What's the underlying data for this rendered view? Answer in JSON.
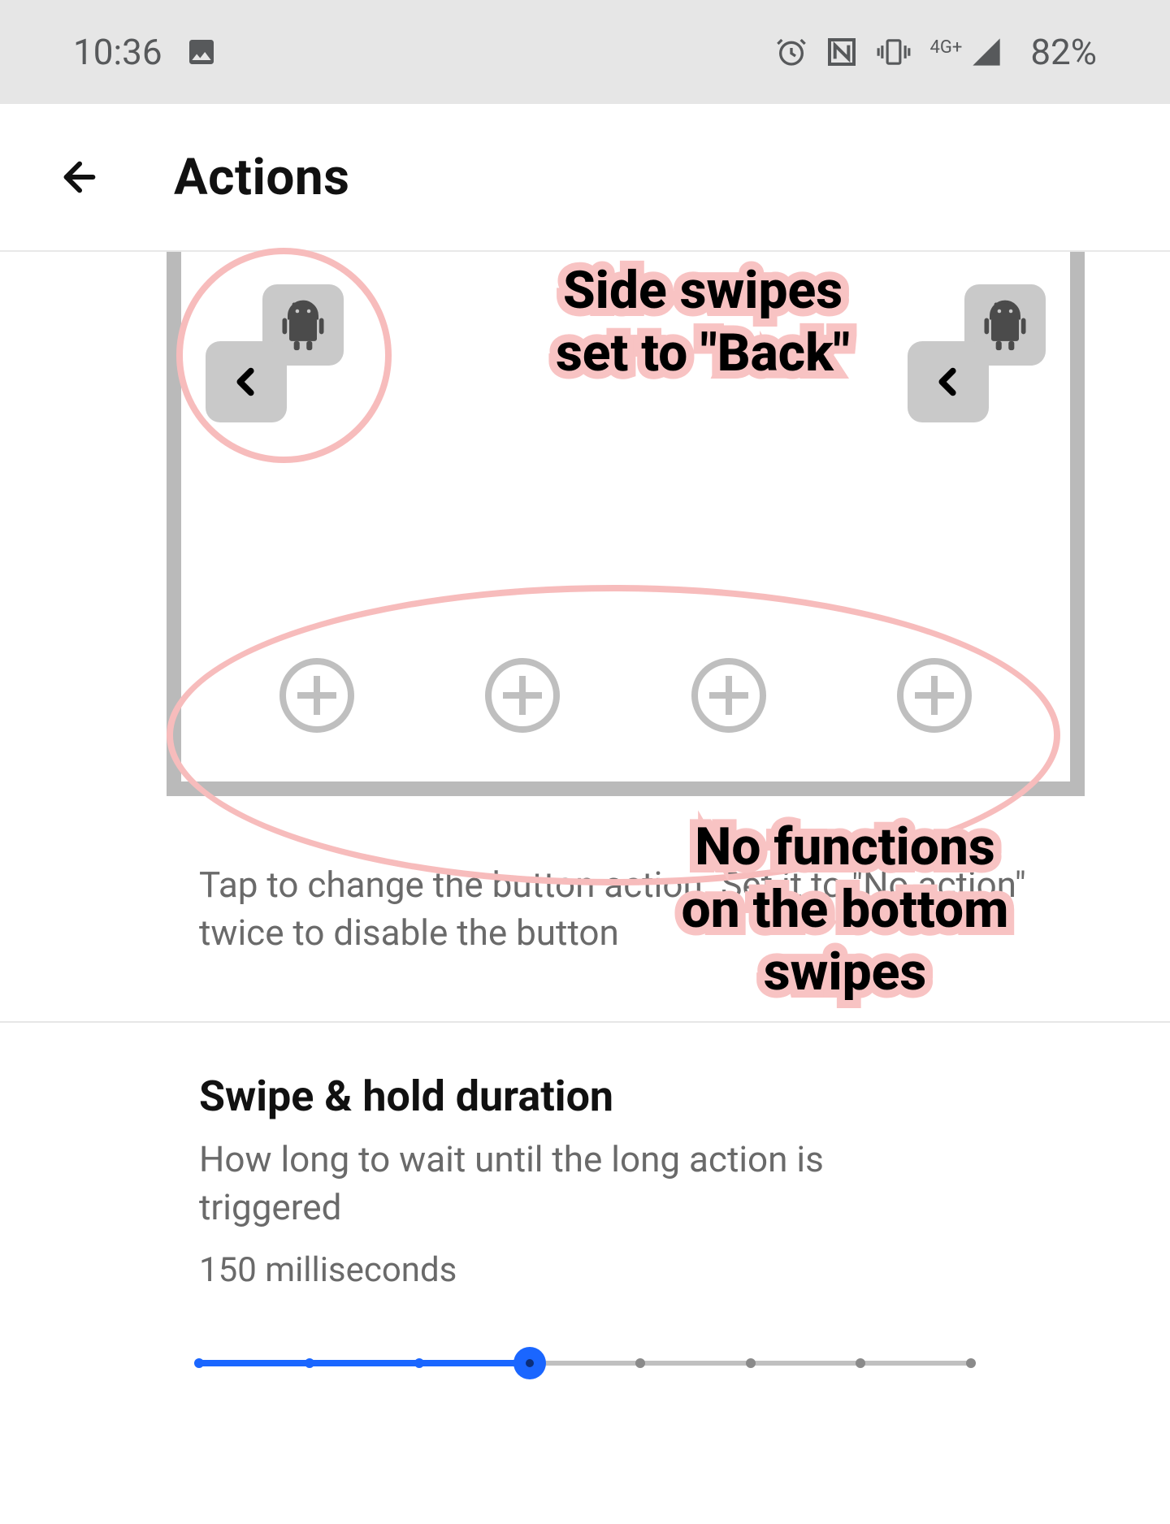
{
  "status_bar": {
    "time": "10:36",
    "battery": "82%",
    "network_label": "4G+",
    "icons": [
      "picture-icon",
      "alarm-icon",
      "nfc-icon",
      "vibrate-icon",
      "signal-icon"
    ]
  },
  "app_bar": {
    "title": "Actions"
  },
  "preview": {
    "left_tile": {
      "primary": "back",
      "secondary": "android"
    },
    "right_tile": {
      "primary": "back",
      "secondary": "android"
    },
    "bottom_slot_count": 4
  },
  "helper_text": "Tap to change the button action. Set it to \"No action\" twice to disable the button",
  "annotations": {
    "a1": "Side swipes\nset to \"Back\"",
    "a2": "No functions\non the bottom\nswipes"
  },
  "section": {
    "title": "Swipe & hold duration",
    "subtitle": "How long to wait until the long action is triggered",
    "value": "150 milliseconds"
  },
  "slider": {
    "ticks": 8,
    "active_index": 3
  }
}
